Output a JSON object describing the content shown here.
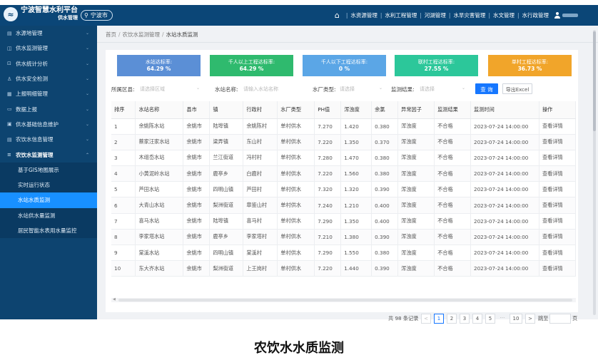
{
  "header": {
    "app_title": "宁波智慧水利平台",
    "app_subtitle": "供水管理",
    "city": "宁波市",
    "nav": [
      "水资源管理",
      "水利工程管理",
      "河湖管理",
      "水旱灾害管理",
      "水文管理",
      "水行政管理"
    ]
  },
  "sidebar": {
    "items": [
      {
        "label": "水源地管理",
        "icon": "reservoir-icon"
      },
      {
        "label": "供水监测管理",
        "icon": "monitor-icon"
      },
      {
        "label": "供水统计分析",
        "icon": "chart-icon"
      },
      {
        "label": "供水安全检测",
        "icon": "safety-icon"
      },
      {
        "label": "上报明细管理",
        "icon": "report-icon"
      },
      {
        "label": "数据上报",
        "icon": "upload-icon"
      },
      {
        "label": "供水基础信息维护",
        "icon": "info-icon"
      },
      {
        "label": "农饮水信息管理",
        "icon": "water-icon"
      },
      {
        "label": "农饮水监测管理",
        "icon": "list-icon"
      }
    ],
    "subitems": [
      {
        "label": "基于GIS地图展示"
      },
      {
        "label": "实时运行状态"
      },
      {
        "label": "水站水质监测"
      },
      {
        "label": "水站供水量监测"
      },
      {
        "label": "居民智能水表用水量监控"
      }
    ]
  },
  "breadcrumb": [
    "首页",
    "农饮水监测管理",
    "水站水质监测"
  ],
  "stats": [
    {
      "label": "水站达标率:",
      "value": "64.29 %",
      "color": "#5b8fd6"
    },
    {
      "label": "千人以上工程达标率:",
      "value": "64.29 %",
      "color": "#2fba6e"
    },
    {
      "label": "千人以下工程达标率:",
      "value": "0 %",
      "color": "#5ba6e6"
    },
    {
      "label": "联村工程达标率:",
      "value": "27.55 %",
      "color": "#2cc79a"
    },
    {
      "label": "单村工程达标率:",
      "value": "36.73 %",
      "color": "#f1a52a"
    }
  ],
  "filters": {
    "area_label": "所属区县:",
    "area_placeholder": "请选择区域",
    "station_label": "水站名称:",
    "station_placeholder": "请输入水站名称",
    "plant_label": "水厂类型:",
    "plant_placeholder": "请选择",
    "result_label": "监测结果:",
    "result_placeholder": "请选择",
    "query_button": "查 询",
    "export_button": "导出Excel"
  },
  "table": {
    "headers": [
      "排序",
      "水站名称",
      "县市",
      "镇",
      "行政村",
      "水厂类型",
      "PH值",
      "浑浊度",
      "余氯",
      "异常因子",
      "监测结果",
      "监测时间",
      "操作"
    ],
    "rows": [
      [
        "1",
        "余姚陈水站",
        "余姚市",
        "陆埠镇",
        "余姚陈村",
        "单村供水",
        "7.270",
        "1.420",
        "0.380",
        "浑浊度",
        "不合格",
        "2023-07-24 14:00:00",
        "查看详情"
      ],
      [
        "2",
        "蔡家汪家水站",
        "余姚市",
        "梁弄镇",
        "东山村",
        "单村供水",
        "7.220",
        "1.350",
        "0.370",
        "浑浊度",
        "不合格",
        "2023-07-24 14:00:00",
        "查看详情"
      ],
      [
        "3",
        "木组岙水站",
        "余姚市",
        "兰江街道",
        "冯村村",
        "单村供水",
        "7.280",
        "1.470",
        "0.380",
        "浑浊度",
        "不合格",
        "2023-07-24 14:00:00",
        "查看详情"
      ],
      [
        "4",
        "小黄泥岭水站",
        "余姚市",
        "鹿亭乡",
        "白鹿村",
        "单村供水",
        "7.220",
        "1.560",
        "0.380",
        "浑浊度",
        "不合格",
        "2023-07-24 14:00:00",
        "查看详情"
      ],
      [
        "5",
        "芦田水站",
        "余姚市",
        "四明山镇",
        "芦田村",
        "单村供水",
        "7.320",
        "1.320",
        "0.390",
        "浑浊度",
        "不合格",
        "2023-07-24 14:00:00",
        "查看详情"
      ],
      [
        "6",
        "大青山水站",
        "余姚市",
        "梨洲街道",
        "章鉴山村",
        "单村供水",
        "7.240",
        "1.210",
        "0.400",
        "浑浊度",
        "不合格",
        "2023-07-24 14:00:00",
        "查看详情"
      ],
      [
        "7",
        "喜马水站",
        "余姚市",
        "陆埠镇",
        "喜马村",
        "单村供水",
        "7.290",
        "1.350",
        "0.400",
        "浑浊度",
        "不合格",
        "2023-07-24 14:00:00",
        "查看详情"
      ],
      [
        "8",
        "李家塔水站",
        "余姚市",
        "鹿亭乡",
        "李家塔村",
        "单村供水",
        "7.210",
        "1.380",
        "0.390",
        "浑浊度",
        "不合格",
        "2023-07-24 14:00:00",
        "查看详情"
      ],
      [
        "9",
        "棠溪水站",
        "余姚市",
        "四明山镇",
        "棠溪村",
        "单村供水",
        "7.290",
        "1.550",
        "0.380",
        "浑浊度",
        "不合格",
        "2023-07-24 14:00:00",
        "查看详情"
      ],
      [
        "10",
        "东大岕水站",
        "余姚市",
        "梨洲街道",
        "上王岗村",
        "单村供水",
        "7.220",
        "1.440",
        "0.390",
        "浑浊度",
        "不合格",
        "2023-07-24 14:00:00",
        "查看详情"
      ]
    ]
  },
  "pagination": {
    "total_text": "共 98 条记录",
    "prev": "<",
    "pages": [
      "1",
      "2",
      "3",
      "4",
      "5"
    ],
    "ellipsis": "···",
    "last_page": "10",
    "next": ">",
    "goto_label": "跳至",
    "goto_suffix": "页"
  },
  "caption": "农饮水水质监测"
}
